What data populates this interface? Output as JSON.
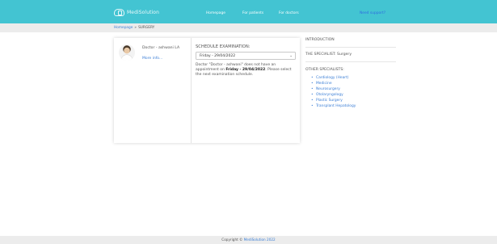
{
  "header": {
    "logo_text": "MediSolution",
    "nav": {
      "homepage": "Homepage",
      "for_patients": "For patients",
      "for_doctors": "For doctors",
      "support": "Need support?"
    }
  },
  "breadcrumb": {
    "home": "Homepage",
    "separator": "»",
    "current": "SURGERY"
  },
  "doctor": {
    "name": "Doctor - ashwani LA",
    "more_info": "More info..."
  },
  "schedule": {
    "title": "SCHEDULE EXAMINATION:",
    "selected_date": "Friday - 29/04/2022",
    "note_prefix": "Doctor \"Doctor - ashwani\" does not have an appointment on ",
    "note_date": "Friday - 29/04/2022",
    "note_suffix": ". Please select the next examination schedule."
  },
  "sidebar": {
    "introduction": "INTRODUCTION",
    "specialist": "THE SPECIALIST: Surgery",
    "other_specialists": "OTHER SPECIALISTS:",
    "specialists": [
      "Cardiology (Heart)",
      "Medicine",
      "Neurosurgery",
      "Otolaryngology",
      "Plastic Surgery",
      "Transplant Hepatology"
    ]
  },
  "footer": {
    "copyright": "Copyright ©",
    "brand": "MediSolution 2022"
  },
  "colors": {
    "topbar": "#43c4d2",
    "link": "#3c7fd6",
    "support_link": "#2f6de0",
    "gray_bar": "#ececec"
  }
}
